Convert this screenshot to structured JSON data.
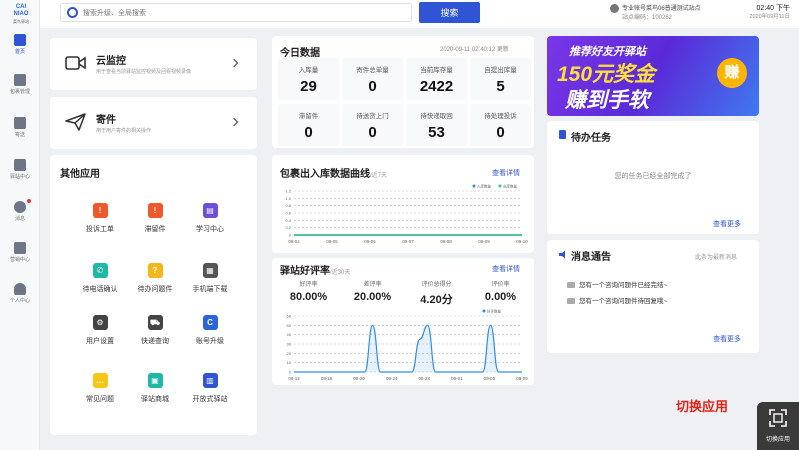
{
  "nav": {
    "logo_main": "CAI\nNIAO",
    "logo_sub": "菜鸟驿站",
    "items": [
      {
        "label": "首页",
        "icon": "home-icon"
      },
      {
        "label": "包裹管理",
        "icon": "package-icon"
      },
      {
        "label": "寄送",
        "icon": "send-icon"
      },
      {
        "label": "驿站中心",
        "icon": "station-icon"
      },
      {
        "label": "消息",
        "icon": "message-icon"
      },
      {
        "label": "营销中心",
        "icon": "marketing-icon"
      },
      {
        "label": "个人中心",
        "icon": "user-icon"
      }
    ]
  },
  "search": {
    "placeholder": "搜索升级、全局搜索",
    "button": "搜索"
  },
  "station": {
    "name": "专业账号菜鸟06普通测试站点",
    "id_label": "站点编码：100262"
  },
  "clock": {
    "time": "02:40 下午",
    "date": "2020年09月11日"
  },
  "cloud_monitor": {
    "title": "云监控",
    "desc": "用于查看当前驿站监控视频及回看视频录像"
  },
  "send": {
    "title": "寄件",
    "desc": "用于用户寄件的相关操作"
  },
  "today": {
    "title": "今日数据",
    "updated": "2020-09-11 02:40:12 更新",
    "stats": [
      {
        "label": "入库量",
        "value": "29"
      },
      {
        "label": "寄件总单量",
        "value": "0"
      },
      {
        "label": "当前库存量",
        "value": "2422"
      },
      {
        "label": "自提出库量",
        "value": "5"
      },
      {
        "label": "滞留件",
        "value": "0"
      },
      {
        "label": "待送货上门",
        "value": "0"
      },
      {
        "label": "待快递取回",
        "value": "53"
      },
      {
        "label": "待处理投诉",
        "value": "0"
      }
    ]
  },
  "other_apps": {
    "title": "其他应用",
    "apps": [
      {
        "label": "投诉工单",
        "icon": "complaint-icon",
        "color": "#f0572a",
        "glyph": "!"
      },
      {
        "label": "滞留件",
        "icon": "stranded-icon",
        "color": "#f0572a",
        "glyph": "!"
      },
      {
        "label": "学习中心",
        "icon": "learning-icon",
        "color": "#6c4fd6",
        "glyph": "▤"
      },
      {
        "label": "待电话确认",
        "icon": "phone-icon",
        "color": "#1fb8a4",
        "glyph": "✆"
      },
      {
        "label": "待办问题件",
        "icon": "question-icon",
        "color": "#f5b61a",
        "glyph": "?"
      },
      {
        "label": "手机端下载",
        "icon": "qrcode-icon",
        "color": "#555555",
        "glyph": "▦"
      },
      {
        "label": "用户设置",
        "icon": "gear-icon",
        "color": "#444444",
        "glyph": "⚙"
      },
      {
        "label": "快递查询",
        "icon": "truck-icon",
        "color": "#444444",
        "glyph": "⛟"
      },
      {
        "label": "账号升级",
        "icon": "cainiao-logo-icon",
        "color": "#2a66d9",
        "glyph": "C"
      },
      {
        "label": "常见问题",
        "icon": "faq-icon",
        "color": "#f5c518",
        "glyph": "…"
      },
      {
        "label": "驿站商城",
        "icon": "shop-icon",
        "color": "#1fb8a4",
        "glyph": "▣"
      },
      {
        "label": "开放式驿站",
        "icon": "open-station-icon",
        "color": "#2f55d4",
        "glyph": "▥"
      }
    ]
  },
  "package_chart": {
    "title": "包裹出入库数据曲线",
    "subtitle": "/近7天",
    "link": "查看详情",
    "legend": [
      "入库数量",
      "出库数量"
    ],
    "chart_data": {
      "type": "line",
      "categories": [
        "09-04",
        "09-05",
        "09-06",
        "09-07",
        "09-08",
        "09-09",
        "09-10"
      ],
      "series": [
        {
          "name": "入库数量",
          "values": [
            0,
            0,
            0,
            0,
            0,
            0,
            0
          ],
          "color": "#2f8df0"
        },
        {
          "name": "出库数量",
          "values": [
            0,
            0,
            0,
            0,
            0,
            0,
            0
          ],
          "color": "#3cc38a"
        }
      ],
      "yticks": [
        "1.2",
        "1.0",
        "0.8",
        "0.6",
        "0.4",
        "0.2",
        "0"
      ],
      "ylim": [
        0,
        1.2
      ]
    }
  },
  "rating_chart": {
    "title": "驿站好评率",
    "subtitle": "/近30天",
    "link": "查看详情",
    "stats": [
      {
        "label": "好评率",
        "value": "80.00%"
      },
      {
        "label": "差评率",
        "value": "20.00%"
      },
      {
        "label": "评价总得分",
        "value": "4.20分"
      },
      {
        "label": "评价率",
        "value": "0.00%"
      }
    ],
    "legend": [
      "好评数量"
    ],
    "chart_data": {
      "type": "area",
      "categories": [
        "08-12",
        "08-16",
        "08-20",
        "08-24",
        "08-28",
        "09-01",
        "09-05",
        "09-09"
      ],
      "x_count": 30,
      "peaks": [
        {
          "x": 10,
          "value": 50
        },
        {
          "x": 16,
          "value": 35
        },
        {
          "x": 17,
          "value": 50
        },
        {
          "x": 25,
          "value": 50
        }
      ],
      "yticks": [
        "60",
        "50",
        "40",
        "30",
        "20",
        "10",
        "0"
      ],
      "ylim": [
        0,
        60
      ],
      "color": "#2f8df0"
    }
  },
  "banner": {
    "line1": "推荐好友开驿站",
    "line2": "150元奖金",
    "line3": "赚到手软",
    "badge": "赚"
  },
  "todo": {
    "title": "待办任务",
    "empty": "您的任务已经全部完成了",
    "more": "查看更多"
  },
  "notice": {
    "title": "消息通告",
    "hint": "此条为最新消息",
    "items": [
      "您有一个咨询问题件已经完结~",
      "您有一个咨询问题件待回复哦~"
    ],
    "more": "查看更多"
  },
  "switch_app": {
    "label_big": "切换应用",
    "label_small": "切换应用"
  }
}
